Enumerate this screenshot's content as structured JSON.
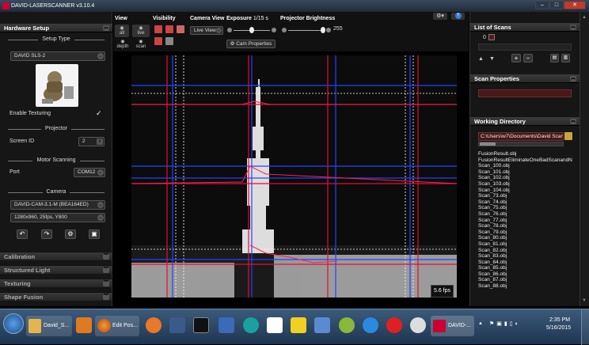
{
  "window": {
    "title": "DAVID-LASERSCANNER v3.10.4"
  },
  "left_panel": {
    "title": "Hardware Setup",
    "setup_type_label": "Setup Type",
    "setup_type_value": "DAVID SLS-2",
    "enable_texturing_label": "Enable Texturing",
    "enable_texturing_checked": true,
    "projector_label": "Projector",
    "screen_id_label": "Screen ID",
    "screen_id_value": "2",
    "motor_scanning_label": "Motor Scanning",
    "port_label": "Port",
    "port_value": "COM12",
    "camera_label": "Camera",
    "camera_value": "DAVID-CAM-3.1-M (BEA164ED)",
    "format_value": "1280x960, 25fps, Y800",
    "sections": [
      "Calibration",
      "Structured Light",
      "Texturing",
      "Shape Fusion"
    ]
  },
  "toolbar": {
    "view_label": "View",
    "view_all": "all",
    "view_live": "live",
    "view_depth": "depth",
    "view_scan": "scan",
    "visibility_label": "Visibility",
    "camera_view_label": "Camera View",
    "camera_view_value": "Live View",
    "exposure_label": "Exposure",
    "exposure_value": "1/15 s",
    "cam_properties": "Cam Properties",
    "projector_brightness_label": "Projector Brightness",
    "projector_brightness_value": "255"
  },
  "viewport": {
    "fps": "5.6 fps"
  },
  "right_panel": {
    "list_of_scans": "List of Scans",
    "scan_index": "0",
    "scan_properties": "Scan Properties",
    "working_directory": "Working Directory",
    "directory_path": "C:\\Users\\w7\\Documents\\David Scan",
    "files": [
      "FusionResult.obj",
      "FusionResultEliminateOneBadScanandN",
      "Scan_100.obj",
      "Scan_101.obj",
      "Scan_102.obj",
      "Scan_103.obj",
      "Scan_104.obj",
      "Scan_73.obj",
      "Scan_74.obj",
      "Scan_75.obj",
      "Scan_76.obj",
      "Scan_77.obj",
      "Scan_78.obj",
      "Scan_79.obj",
      "Scan_80.obj",
      "Scan_81.obj",
      "Scan_82.obj",
      "Scan_83.obj",
      "Scan_84.obj",
      "Scan_85.obj",
      "Scan_86.obj",
      "Scan_87.obj",
      "Scan_88.obj"
    ]
  },
  "taskbar": {
    "items": [
      "David_S...",
      "Edit Pos...",
      "DAVID-..."
    ],
    "time": "2:35 PM",
    "date": "5/16/2015"
  }
}
